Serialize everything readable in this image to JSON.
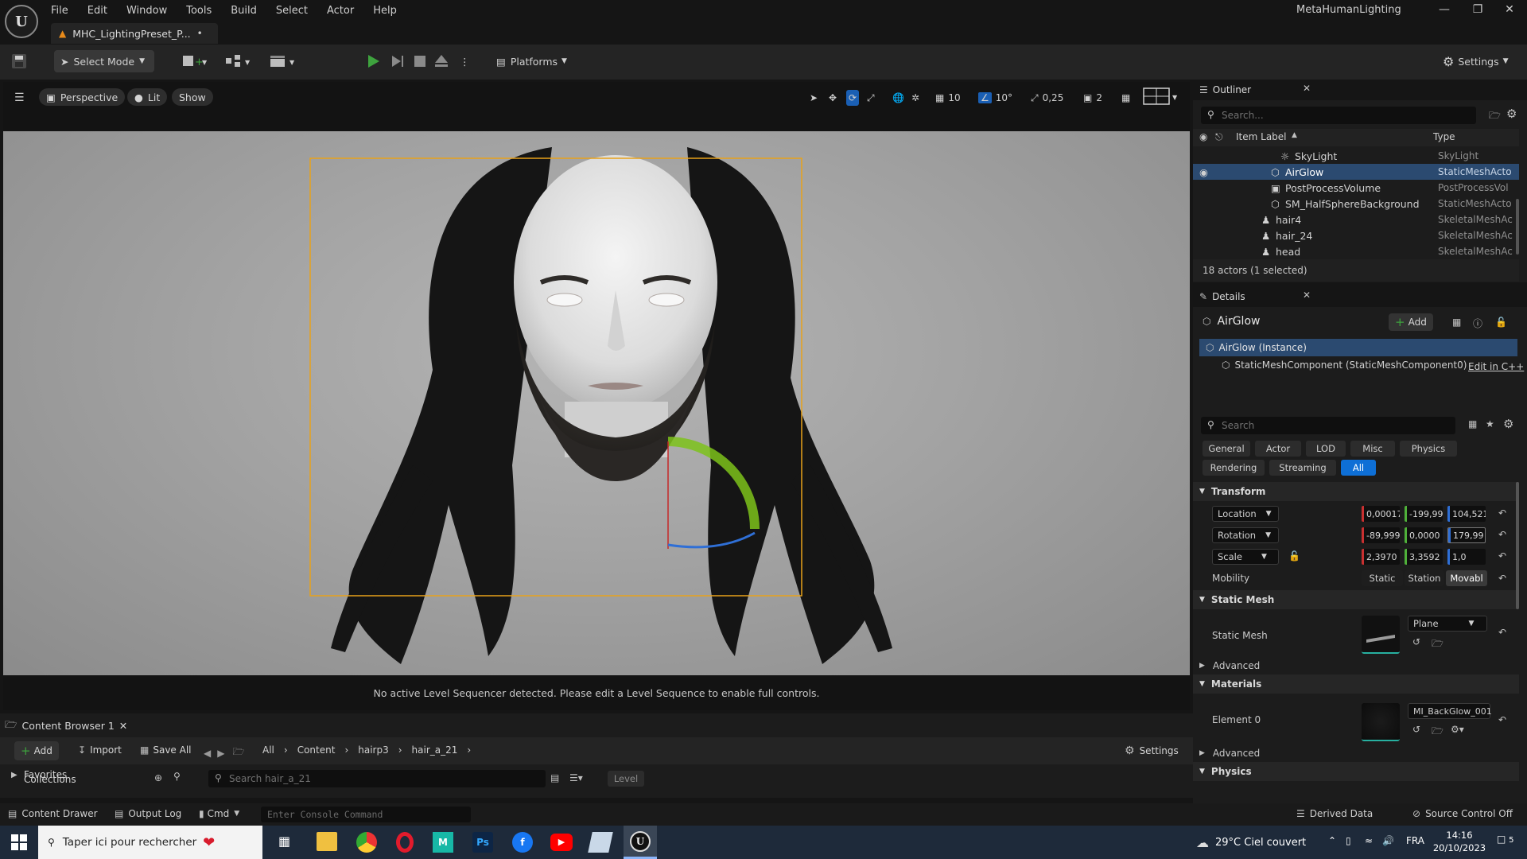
{
  "menu": [
    "File",
    "Edit",
    "Window",
    "Tools",
    "Build",
    "Select",
    "Actor",
    "Help"
  ],
  "app_title": "MetaHumanLighting",
  "doc_tab": {
    "label": "MHC_LightingPreset_P...",
    "modified": "•"
  },
  "toolbar": {
    "select_mode": "Select Mode",
    "platforms": "Platforms",
    "settings": "Settings"
  },
  "viewport": {
    "perspective": "Perspective",
    "lit": "Lit",
    "show": "Show",
    "grid_snap": "10",
    "rot_snap": "10°",
    "scale_snap": "0,25",
    "camera_speed": "2",
    "message": "No active Level Sequencer detected. Please edit a Level Sequence to enable full controls."
  },
  "content_browser": {
    "tab": "Content Browser 1",
    "add": "Add",
    "import": "Import",
    "save_all": "Save All",
    "path": [
      "All",
      "Content",
      "hairp3",
      "hair_a_21"
    ],
    "settings": "Settings",
    "favorites": "Favorites",
    "collections": "Collections",
    "search_placeholder": "Search hair_a_21",
    "level": "Level"
  },
  "statusbar": {
    "content_drawer": "Content Drawer",
    "output_log": "Output Log",
    "cmd": "Cmd",
    "console_placeholder": "Enter Console Command",
    "derived_data": "Derived Data",
    "source_control": "Source Control Off"
  },
  "outliner": {
    "title": "Outliner",
    "search_placeholder": "Search...",
    "col_label": "Item Label",
    "col_type": "Type",
    "rows": [
      {
        "label": "SkyLight",
        "type": "SkyLight"
      },
      {
        "label": "AirGlow",
        "type": "StaticMeshActo"
      },
      {
        "label": "PostProcessVolume",
        "type": "PostProcessVol"
      },
      {
        "label": "SM_HalfSphereBackground",
        "type": "StaticMeshActo"
      },
      {
        "label": "hair4",
        "type": "SkeletalMeshAc"
      },
      {
        "label": "hair_24",
        "type": "SkeletalMeshAc"
      },
      {
        "label": "head",
        "type": "SkeletalMeshAc"
      }
    ],
    "footer": "18 actors (1 selected)"
  },
  "details": {
    "title": "Details",
    "actor_name": "AirGlow",
    "add": "Add",
    "instance": "AirGlow (Instance)",
    "component": "StaticMeshComponent (StaticMeshComponent0)",
    "edit_cpp": "Edit in C++",
    "search_placeholder": "Search",
    "filters_row1": [
      "General",
      "Actor",
      "LOD",
      "Misc",
      "Physics"
    ],
    "filters_row2": [
      "Rendering",
      "Streaming",
      "All"
    ],
    "transform": {
      "section": "Transform",
      "location_label": "Location",
      "location": [
        "0,00017",
        "-199,99",
        "104,521"
      ],
      "rotation_label": "Rotation",
      "rotation": [
        "-89,999",
        "0,0000",
        "179,99"
      ],
      "scale_label": "Scale",
      "scale": [
        "2,3970",
        "3,3592",
        "1,0"
      ],
      "mobility_label": "Mobility",
      "mobility": [
        "Static",
        "Station",
        "Movabl"
      ]
    },
    "static_mesh": {
      "section": "Static Mesh",
      "label": "Static Mesh",
      "value": "Plane",
      "advanced": "Advanced"
    },
    "materials": {
      "section": "Materials",
      "element_label": "Element 0",
      "value": "MI_BackGlow_001",
      "advanced": "Advanced"
    },
    "physics": {
      "section": "Physics"
    }
  },
  "taskbar": {
    "search_placeholder": "Taper ici pour rechercher",
    "weather": "29°C  Ciel couvert",
    "lang": "FRA",
    "time": "14:16",
    "date": "20/10/2023",
    "notifications": "5"
  },
  "colors": {
    "accent_blue": "#0e6fd6",
    "selection": "#2b4a70",
    "play_green": "#3ea33e",
    "select_outline": "#e8a21a"
  }
}
